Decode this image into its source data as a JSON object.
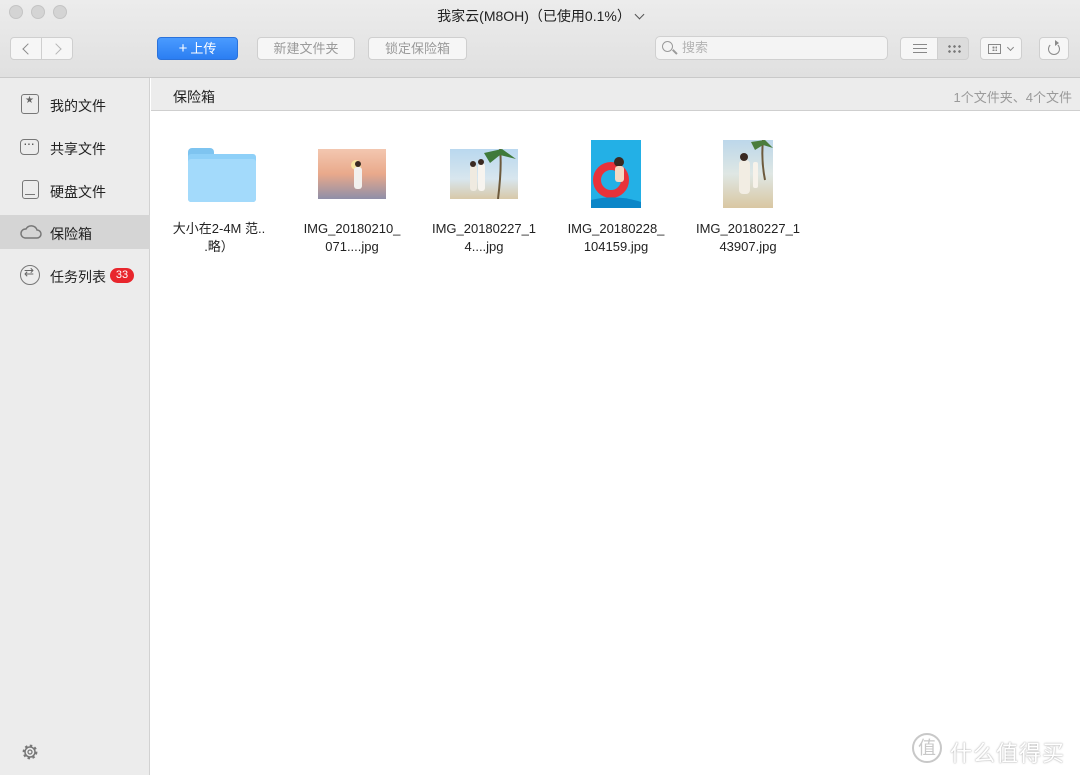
{
  "window": {
    "title": "我家云(M8OH)（已使用0.1%）"
  },
  "toolbar": {
    "upload_label": "上传",
    "new_folder_label": "新建文件夹",
    "lock_vault_label": "锁定保险箱",
    "search_placeholder": "搜索"
  },
  "sidebar": {
    "items": [
      {
        "label": "我的文件",
        "icon": "star-doc-icon"
      },
      {
        "label": "共享文件",
        "icon": "share-icon"
      },
      {
        "label": "硬盘文件",
        "icon": "disk-icon"
      },
      {
        "label": "保险箱",
        "icon": "cloud-icon",
        "active": true
      },
      {
        "label": "任务列表",
        "icon": "transfer-icon",
        "badge": "33"
      }
    ]
  },
  "main": {
    "path_title": "保险箱",
    "summary": "1个文件夹、4个文件",
    "files": [
      {
        "name": "大小在2-4M 范..\n.略）",
        "type": "folder"
      },
      {
        "name": "IMG_20180210_\n071....jpg",
        "type": "image"
      },
      {
        "name": "IMG_20180227_1\n4....jpg",
        "type": "image"
      },
      {
        "name": "IMG_20180228_\n104159.jpg",
        "type": "image"
      },
      {
        "name": "IMG_20180227_1\n43907.jpg",
        "type": "image"
      }
    ]
  },
  "watermark": {
    "text": "什么值得买",
    "logo": "值"
  }
}
